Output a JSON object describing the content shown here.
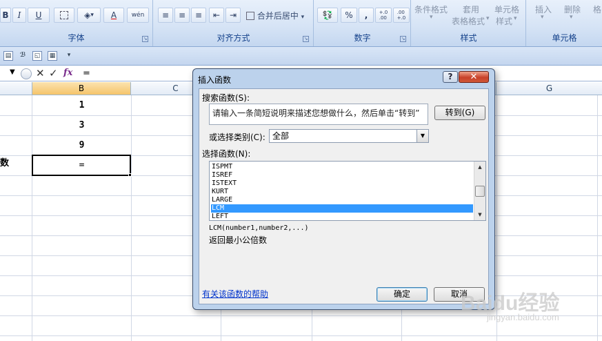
{
  "ribbon": {
    "font_group": {
      "label": "字体",
      "bold": "B",
      "italic": "I",
      "underline": "U",
      "fill_arrow": "▾",
      "font_color": "A",
      "phonetic": "wén"
    },
    "align_group": {
      "label": "对齐方式",
      "merge_center": "合并后居中"
    },
    "number_group": {
      "label": "数字",
      "percent": "%",
      "comma": ",",
      "increase_decimal": "+.0\n.00",
      "decrease_decimal": ".00\n+.0"
    },
    "style_group": {
      "label": "样式",
      "conditional_format": "条件格式",
      "table_format_1": "套用",
      "table_format_2": "表格格式",
      "cell_style_1": "单元格",
      "cell_style_2": "样式"
    },
    "cells_group": {
      "label": "单元格",
      "insert": "插入",
      "delete": "删除",
      "format": "格"
    }
  },
  "formula_bar": {
    "value": "=",
    "fx": "fx",
    "cancel": "✕",
    "enter": "✓"
  },
  "sheet": {
    "columns": [
      {
        "label": "B",
        "selected": true
      },
      {
        "label": "C",
        "selected": false
      },
      {
        "label": "G",
        "selected": false
      }
    ],
    "cells": [
      "1",
      "3",
      "9",
      "="
    ],
    "row_label": "数"
  },
  "dialog": {
    "title": "插入函数",
    "help_btn": "?",
    "close_btn": "✕",
    "search_label": "搜索函数(S):",
    "search_value": "请输入一条简短说明来描述您想做什么，然后单击“转到”",
    "go_button": "转到(G)",
    "category_label": "或选择类别(C):",
    "category_value": "全部",
    "select_label": "选择函数(N):",
    "functions": [
      "ISPMT",
      "ISREF",
      "ISTEXT",
      "KURT",
      "LARGE",
      "LCM",
      "LEFT"
    ],
    "selected_function": "LCM",
    "syntax": "LCM(number1,number2,...)",
    "description": "返回最小公倍数",
    "help_link": "有关该函数的帮助",
    "ok_button": "确定",
    "cancel_button": "取消"
  },
  "watermark": {
    "logo": "Baidu经验",
    "url": "jingyan.baidu.com"
  }
}
